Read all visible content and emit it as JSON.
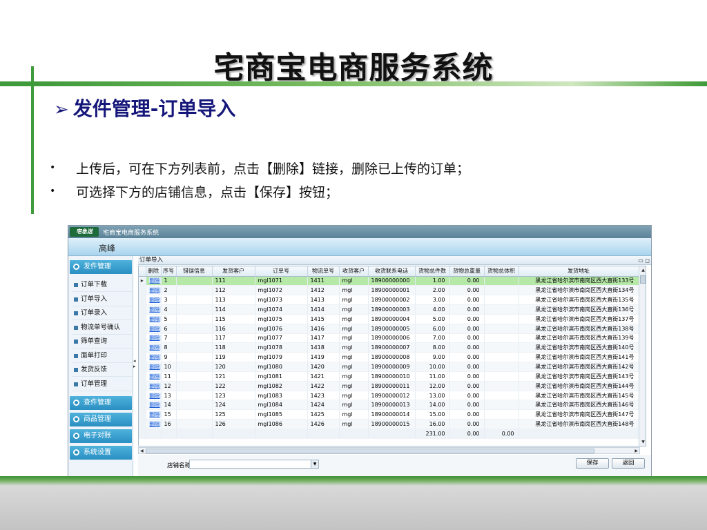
{
  "slide": {
    "title": "宅商宝电商服务系统",
    "heading_arrow": "➢",
    "heading": "发件管理-订单导入",
    "bullets": [
      "上传后，可在下方列表前，点击【删除】链接，删除已上传的订单；",
      "可选择下方的店铺信息，点击【保存】按钮；"
    ]
  },
  "app": {
    "logo_text": "宅急送",
    "window_title": "宅商宝电商服务系统",
    "user_name": "高峰",
    "sidebar": {
      "sections_top": [
        {
          "label": "发件管理",
          "expanded": true
        }
      ],
      "items": [
        "订单下载",
        "订单导入",
        "订单录入",
        "物流单号确认",
        "筛单查询",
        "面单打印",
        "发货反馈",
        "订单管理"
      ],
      "sections_bottom": [
        "查件管理",
        "商品管理",
        "电子对账",
        "系统设置"
      ]
    },
    "panel": {
      "title": "订单导入",
      "window_controls": "▭ ◻",
      "columns": [
        "删除",
        "序号",
        "错误信息",
        "发货客户",
        "订单号",
        "物流单号",
        "收货客户",
        "收货联系电话",
        "货物总件数",
        "货物总重量",
        "货物总体积",
        "发货地址"
      ],
      "delete_link": "删除",
      "rows": [
        {
          "seq": "1",
          "error": "",
          "customer": "111",
          "order_no": "mgl1071",
          "tracking_no": "1411",
          "receiver": "mgl",
          "phone": "18900000000",
          "pieces": "1.00",
          "weight": "0.00",
          "volume": "",
          "address": "黑龙江省哈尔滨市南岗区西大直街133号",
          "selected": true
        },
        {
          "seq": "2",
          "error": "",
          "customer": "112",
          "order_no": "mgl1072",
          "tracking_no": "1412",
          "receiver": "mgl",
          "phone": "18900000001",
          "pieces": "2.00",
          "weight": "0.00",
          "volume": "",
          "address": "黑龙江省哈尔滨市南岗区西大直街134号"
        },
        {
          "seq": "3",
          "error": "",
          "customer": "113",
          "order_no": "mgl1073",
          "tracking_no": "1413",
          "receiver": "mgl",
          "phone": "18900000002",
          "pieces": "3.00",
          "weight": "0.00",
          "volume": "",
          "address": "黑龙江省哈尔滨市南岗区西大直街135号"
        },
        {
          "seq": "4",
          "error": "",
          "customer": "114",
          "order_no": "mgl1074",
          "tracking_no": "1414",
          "receiver": "mgl",
          "phone": "18900000003",
          "pieces": "4.00",
          "weight": "0.00",
          "volume": "",
          "address": "黑龙江省哈尔滨市南岗区西大直街136号"
        },
        {
          "seq": "5",
          "error": "",
          "customer": "115",
          "order_no": "mgl1075",
          "tracking_no": "1415",
          "receiver": "mgl",
          "phone": "18900000004",
          "pieces": "5.00",
          "weight": "0.00",
          "volume": "",
          "address": "黑龙江省哈尔滨市南岗区西大直街137号"
        },
        {
          "seq": "6",
          "error": "",
          "customer": "116",
          "order_no": "mgl1076",
          "tracking_no": "1416",
          "receiver": "mgl",
          "phone": "18900000005",
          "pieces": "6.00",
          "weight": "0.00",
          "volume": "",
          "address": "黑龙江省哈尔滨市南岗区西大直街138号"
        },
        {
          "seq": "7",
          "error": "",
          "customer": "117",
          "order_no": "mgl1077",
          "tracking_no": "1417",
          "receiver": "mgl",
          "phone": "18900000006",
          "pieces": "7.00",
          "weight": "0.00",
          "volume": "",
          "address": "黑龙江省哈尔滨市南岗区西大直街139号"
        },
        {
          "seq": "8",
          "error": "",
          "customer": "118",
          "order_no": "mgl1078",
          "tracking_no": "1418",
          "receiver": "mgl",
          "phone": "18900000007",
          "pieces": "8.00",
          "weight": "0.00",
          "volume": "",
          "address": "黑龙江省哈尔滨市南岗区西大直街140号"
        },
        {
          "seq": "9",
          "error": "",
          "customer": "119",
          "order_no": "mgl1079",
          "tracking_no": "1419",
          "receiver": "mgl",
          "phone": "18900000008",
          "pieces": "9.00",
          "weight": "0.00",
          "volume": "",
          "address": "黑龙江省哈尔滨市南岗区西大直街141号"
        },
        {
          "seq": "10",
          "error": "",
          "customer": "120",
          "order_no": "mgl1080",
          "tracking_no": "1420",
          "receiver": "mgl",
          "phone": "18900000009",
          "pieces": "10.00",
          "weight": "0.00",
          "volume": "",
          "address": "黑龙江省哈尔滨市南岗区西大直街142号"
        },
        {
          "seq": "11",
          "error": "",
          "customer": "121",
          "order_no": "mgl1081",
          "tracking_no": "1421",
          "receiver": "mgl",
          "phone": "18900000010",
          "pieces": "11.00",
          "weight": "0.00",
          "volume": "",
          "address": "黑龙江省哈尔滨市南岗区西大直街143号"
        },
        {
          "seq": "12",
          "error": "",
          "customer": "122",
          "order_no": "mgl1082",
          "tracking_no": "1422",
          "receiver": "mgl",
          "phone": "18900000011",
          "pieces": "12.00",
          "weight": "0.00",
          "volume": "",
          "address": "黑龙江省哈尔滨市南岗区西大直街144号"
        },
        {
          "seq": "13",
          "error": "",
          "customer": "123",
          "order_no": "mgl1083",
          "tracking_no": "1423",
          "receiver": "mgl",
          "phone": "18900000012",
          "pieces": "13.00",
          "weight": "0.00",
          "volume": "",
          "address": "黑龙江省哈尔滨市南岗区西大直街145号"
        },
        {
          "seq": "14",
          "error": "",
          "customer": "124",
          "order_no": "mgl1084",
          "tracking_no": "1424",
          "receiver": "mgl",
          "phone": "18900000013",
          "pieces": "14.00",
          "weight": "0.00",
          "volume": "",
          "address": "黑龙江省哈尔滨市南岗区西大直街146号"
        },
        {
          "seq": "15",
          "error": "",
          "customer": "125",
          "order_no": "mgl1085",
          "tracking_no": "1425",
          "receiver": "mgl",
          "phone": "18900000014",
          "pieces": "15.00",
          "weight": "0.00",
          "volume": "",
          "address": "黑龙江省哈尔滨市南岗区西大直街147号"
        },
        {
          "seq": "16",
          "error": "",
          "customer": "126",
          "order_no": "mgl1086",
          "tracking_no": "1426",
          "receiver": "mgl",
          "phone": "18900000015",
          "pieces": "16.00",
          "weight": "0.00",
          "volume": "",
          "address": "黑龙江省哈尔滨市南岗区西大直街148号"
        }
      ],
      "totals": {
        "pieces": "231.00",
        "weight": "0.00",
        "volume": "0.00"
      },
      "store_label": "店铺名称",
      "store_value": "",
      "save_button": "保存",
      "back_button": "返回"
    }
  },
  "colors": {
    "brand_green": "#3f9a3b",
    "heading_navy": "#16177a",
    "nav_blue": "#2a8fc2",
    "selected_row": "#b6e8a8",
    "link_blue": "#1f5fd8"
  }
}
